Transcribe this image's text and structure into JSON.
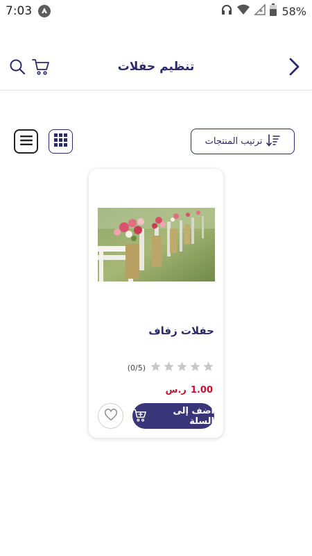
{
  "status_bar": {
    "time": "7:03",
    "battery": "58%"
  },
  "header": {
    "title": "تنظيم حفلات",
    "icons": [
      "search-icon",
      "cart-icon",
      "chevron-right-icon"
    ]
  },
  "toolbar": {
    "sort_label": "ترتيب المنتجات",
    "view_modes": [
      "list-view",
      "grid-view"
    ]
  },
  "products": [
    {
      "title": "حفلات زفاف",
      "rating": 0,
      "rating_max": 5,
      "rating_count": "(0/5)",
      "price": "1.00",
      "currency": "ر.س",
      "add_to_cart_label": "أضف إلى السلة"
    }
  ],
  "colors": {
    "brand": "#2b2a6a",
    "button": "#3a3579",
    "price": "#c8102e",
    "star_empty": "#c8c8cc"
  }
}
